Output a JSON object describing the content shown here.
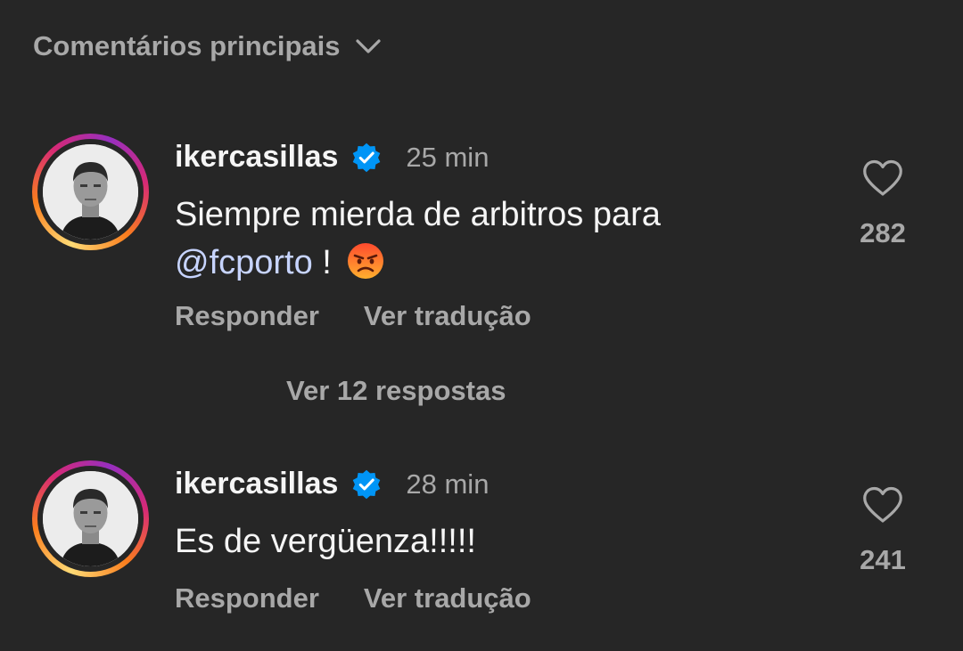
{
  "header": {
    "sort_label": "Comentários principais"
  },
  "comments": [
    {
      "username": "ikercasillas",
      "time": "25 min",
      "text_line1": "Siempre mierda de arbitros para",
      "mention": "@fcporto",
      "text_after_mention": " !",
      "emoji": "angry-face",
      "reply_label": "Responder",
      "translate_label": "Ver tradução",
      "likes": "282"
    },
    {
      "username": "ikercasillas",
      "time": "28 min",
      "text_line1": "Es de vergüenza!!!!!",
      "reply_label": "Responder",
      "translate_label": "Ver tradução",
      "likes": "241"
    }
  ],
  "view_replies_label": "Ver 12 respostas",
  "colors": {
    "background": "#262626",
    "primary_text": "#f5f5f5",
    "secondary_text": "#a8a8a8",
    "mention": "#c7d4ff",
    "verified": "#0095f6"
  }
}
